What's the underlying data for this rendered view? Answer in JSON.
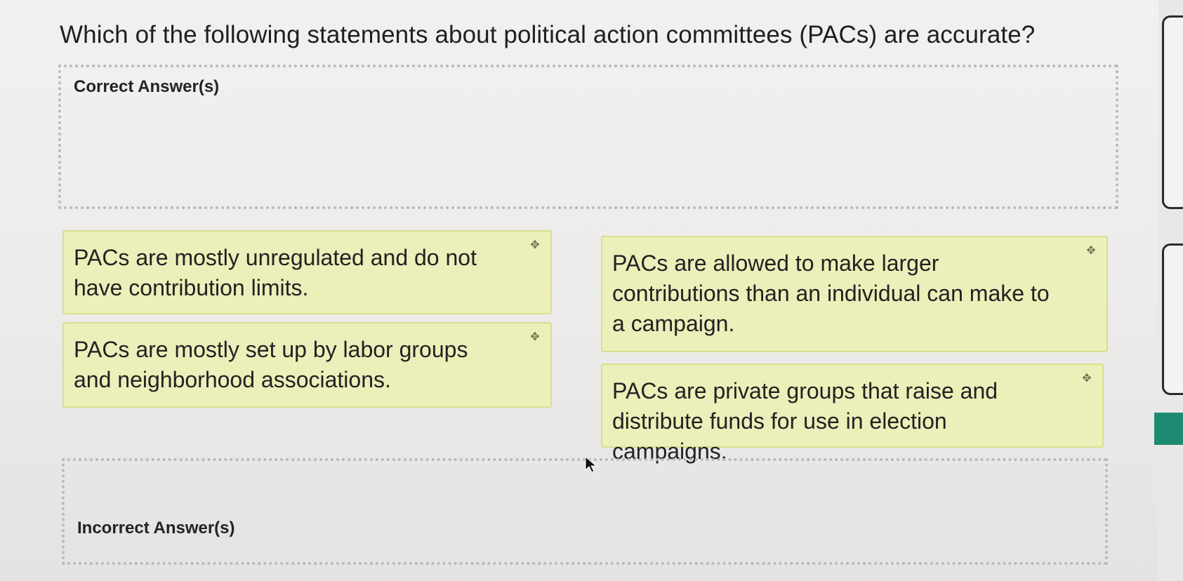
{
  "question": "Which of the following statements about political action committees (PACs) are accurate?",
  "correct_zone": {
    "label": "Correct Answer(s)"
  },
  "incorrect_zone": {
    "label": "Incorrect Answer(s)"
  },
  "cards": [
    {
      "text": "PACs are mostly unregulated and do not have contribution limits.",
      "icon": "move-icon"
    },
    {
      "text": "PACs are mostly set up by labor groups and neighborhood associations.",
      "icon": "move-icon"
    },
    {
      "text": "PACs are allowed to make larger contributions than an individual can make to a campaign.",
      "icon": "move-icon"
    },
    {
      "text": "PACs are private groups that raise and distribute funds for use in election campaigns.",
      "icon": "move-icon"
    }
  ],
  "colors": {
    "card_fill": "#ecefb9",
    "card_border": "#d9df8c",
    "dropzone_border": "#b4b9c4",
    "accent": "#1f8a72"
  }
}
